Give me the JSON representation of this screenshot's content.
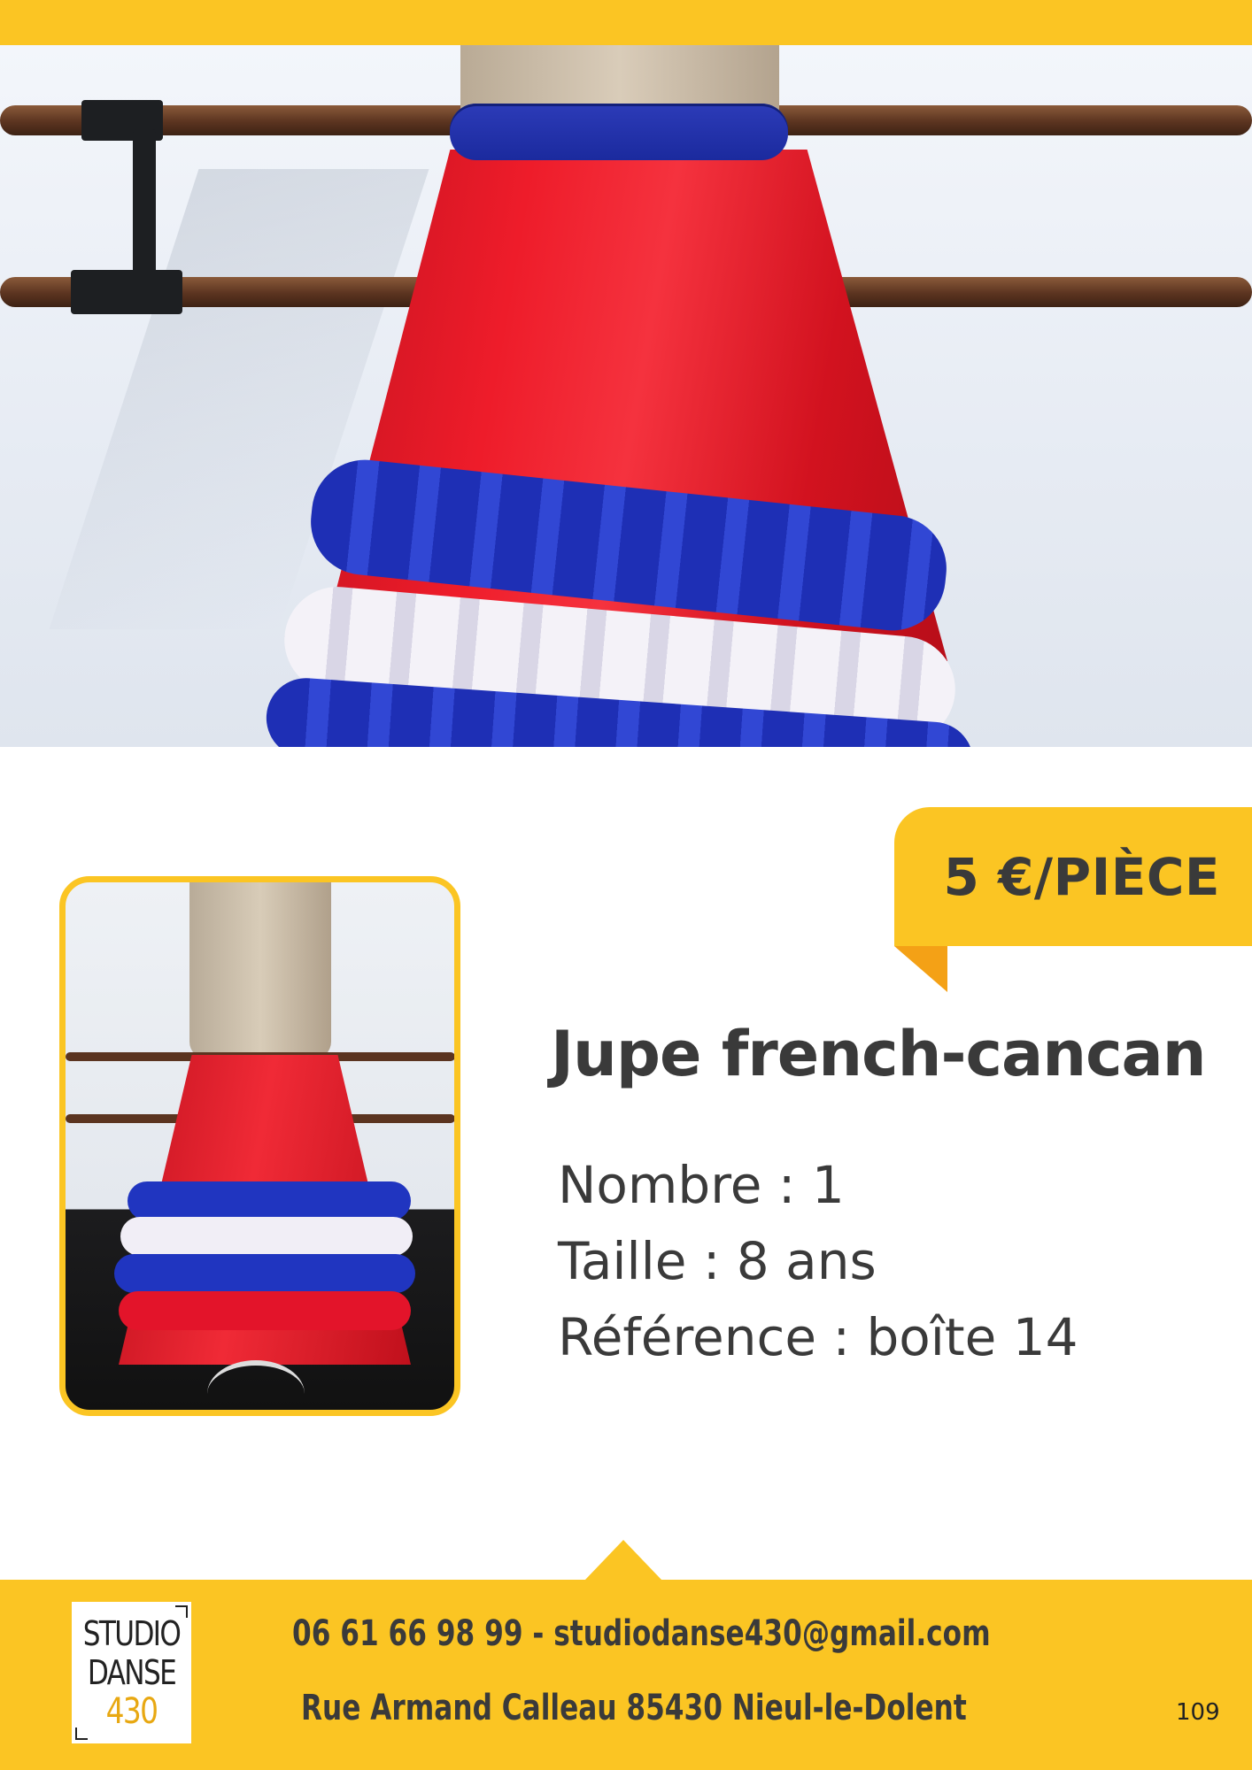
{
  "price": {
    "label": "5 €/PIÈCE"
  },
  "product": {
    "title": "Jupe french-cancan",
    "specs": [
      "Nombre : 1",
      "Taille : 8 ans",
      "Référence : boîte 14"
    ]
  },
  "footer": {
    "logo_lines": [
      "STUDIO",
      "DANSE",
      "430"
    ],
    "contact": "06 61 66 98 99 - studiodanse430@gmail.com",
    "address": "Rue Armand Calleau 85430 Nieul-le-Dolent",
    "page_number": "109"
  },
  "colors": {
    "accent_yellow": "#fbc523",
    "fold_orange": "#f4a116",
    "text_dark": "#3a3a3a"
  }
}
